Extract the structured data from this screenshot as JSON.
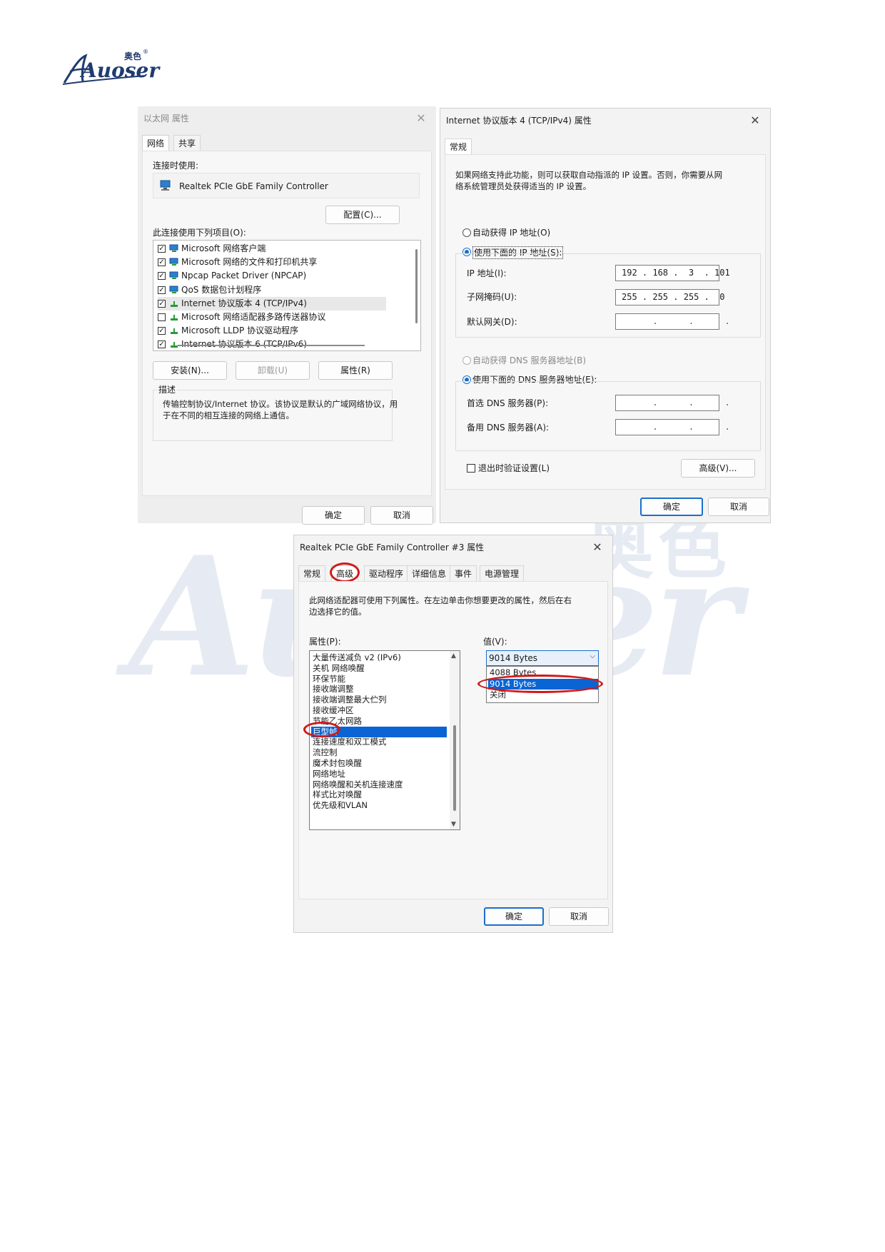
{
  "logo": {
    "brand_cn": "奥色",
    "brand_en": "Auoser",
    "reg": "®"
  },
  "watermark": {
    "brand_cn": "奥色",
    "brand_en": "Auoser"
  },
  "eth_dialog": {
    "title": "以太网 属性",
    "tabs": [
      "网络",
      "共享"
    ],
    "connect_using_label": "连接时使用:",
    "adapter_name": "Realtek PCIe GbE Family Controller",
    "configure_button": "配置(C)...",
    "items_label": "此连接使用下列项目(O):",
    "items": [
      {
        "checked": true,
        "label": "Microsoft 网络客户端"
      },
      {
        "checked": true,
        "label": "Microsoft 网络的文件和打印机共享"
      },
      {
        "checked": true,
        "label": "Npcap Packet Driver (NPCAP)"
      },
      {
        "checked": true,
        "label": "QoS 数据包计划程序"
      },
      {
        "checked": true,
        "label": "Internet 协议版本 4 (TCP/IPv4)"
      },
      {
        "checked": false,
        "label": "Microsoft 网络适配器多路传送器协议"
      },
      {
        "checked": true,
        "label": "Microsoft LLDP 协议驱动程序"
      },
      {
        "checked": true,
        "label": "Internet 协议版本 6 (TCP/IPv6)"
      }
    ],
    "install_button": "安装(N)...",
    "uninstall_button": "卸载(U)",
    "properties_button": "属性(R)",
    "description_label": "描述",
    "description_text_1": "传输控制协议/Internet 协议。该协议是默认的广域网络协议，用",
    "description_text_2": "于在不同的相互连接的网络上通信。",
    "ok_button": "确定",
    "cancel_button": "取消"
  },
  "ipv4_dialog": {
    "title": "Internet 协议版本 4 (TCP/IPv4) 属性",
    "tab": "常规",
    "intro_1": "如果网络支持此功能，则可以获取自动指派的 IP 设置。否则，你需要从网",
    "intro_2": "络系统管理员处获得适当的 IP 设置。",
    "auto_ip": "自动获得 IP 地址(O)",
    "manual_ip": "使用下面的 IP 地址(S):",
    "ip_label": "IP 地址(I):",
    "ip_value": "192 . 168 .  3  . 101",
    "mask_label": "子网掩码(U):",
    "mask_value": "255 . 255 . 255 .  0",
    "gateway_label": "默认网关(D):",
    "gateway_value": "      .      .      .",
    "auto_dns": "自动获得 DNS 服务器地址(B)",
    "manual_dns": "使用下面的 DNS 服务器地址(E):",
    "pref_dns_label": "首选 DNS 服务器(P):",
    "pref_dns_value": "      .      .      .",
    "alt_dns_label": "备用 DNS 服务器(A):",
    "alt_dns_value": "      .      .      .",
    "validate_label": "退出时验证设置(L)",
    "advanced_button": "高级(V)...",
    "ok_button": "确定",
    "cancel_button": "取消"
  },
  "realtek_dialog": {
    "title": "Realtek PCIe GbE Family Controller #3 属性",
    "tabs": [
      "常规",
      "高级",
      "驱动程序",
      "详细信息",
      "事件",
      "电源管理"
    ],
    "intro_1": "此网络适配器可使用下列属性。在左边单击你想要更改的属性，然后在右",
    "intro_2": "边选择它的值。",
    "property_label": "属性(P):",
    "value_label": "值(V):",
    "properties": [
      "大量传送减负 v2 (IPv6)",
      "关机 网络唤醒",
      "环保节能",
      "接收端调整",
      "接收端调整最大伫列",
      "接收缓冲区",
      "节能乙太网路",
      "巨型帧",
      "连接速度和双工模式",
      "流控制",
      "魔术封包唤醒",
      "网络地址",
      "网络唤醒和关机连接速度",
      "样式比对唤醒",
      "优先级和VLAN"
    ],
    "selected_property": "巨型帧",
    "value_selected": "9014 Bytes",
    "value_options": [
      "4088 Bytes",
      "9014 Bytes",
      "关闭"
    ],
    "highlighted_option": "9014 Bytes",
    "ok_button": "确定",
    "cancel_button": "取消"
  },
  "colors": {
    "accent": "#1a6fcc",
    "highlight_red": "#d11a1a",
    "selection": "#0a64d4",
    "watermark": "#e6ebf3"
  }
}
